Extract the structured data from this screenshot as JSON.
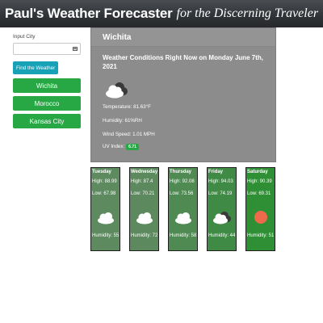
{
  "header": {
    "brand": "Paul's Weather Forecaster",
    "tagline": "for the Discerning Traveler"
  },
  "sidebar": {
    "input_label": "Input City",
    "input_value": "",
    "input_placeholder": "",
    "find_button": "Find the Weather",
    "cities": [
      "Wichita",
      "Morocco",
      "Kansas City"
    ]
  },
  "current": {
    "city": "Wichita",
    "heading": "Weather Conditions Right Now on Monday June 7th, 2021",
    "icon": "partly-cloudy-icon",
    "temperature": "Temperature: 81.63°F",
    "humidity": "Humidity: 61%RH",
    "wind": "Wind Speed: 1.01 MPH",
    "uv_label": "UV Index:",
    "uv_value": "6.71",
    "uv_color": "#28a745"
  },
  "forecast": [
    {
      "day": "Tuesday",
      "high": "High: 88.99",
      "low": "Low: 67.98",
      "icon": "cloud-icon",
      "humidity": "Humidity: 55"
    },
    {
      "day": "Wednesday",
      "high": "High: 87.4",
      "low": "Low: 70.21",
      "icon": "cloud-icon",
      "humidity": "Humidity: 72"
    },
    {
      "day": "Thursday",
      "high": "High: 92.08",
      "low": "Low: 73.56",
      "icon": "cloud-icon",
      "humidity": "Humidity: 58"
    },
    {
      "day": "Friday",
      "high": "High: 94.03",
      "low": "Low: 74.19",
      "icon": "partly-cloudy-icon",
      "humidity": "Humidity: 44"
    },
    {
      "day": "Saturday",
      "high": "High: 90.39",
      "low": "Low: 69.31",
      "icon": "sun-icon",
      "humidity": "Humidity: 51"
    }
  ]
}
